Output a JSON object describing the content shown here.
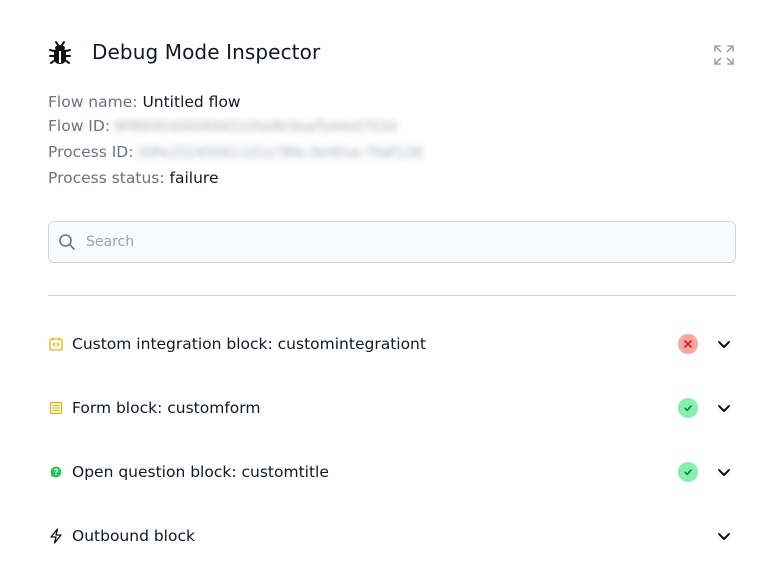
{
  "header": {
    "title": "Debug Mode Inspector",
    "icon": "bug-icon",
    "expand_icon": "expand-icon"
  },
  "meta": {
    "flow_name_label": "Flow name:",
    "flow_name_value": "Untitled flow",
    "flow_id_label": "Flow ID:",
    "flow_id_value": "8ff86954060694510fa9b3baf5d4e07034",
    "process_id_label": "Process ID:",
    "process_id_value": "IDPe25245041101e789c3bf45ac70df128",
    "process_status_label": "Process status:",
    "process_status_value": "failure"
  },
  "search": {
    "placeholder": "Search",
    "value": ""
  },
  "blocks": [
    {
      "label": "Custom integration block: customintegrationt",
      "icon": "code-block-icon",
      "status": "failure"
    },
    {
      "label": "Form block: customform",
      "icon": "form-icon",
      "status": "success"
    },
    {
      "label": "Open question block: customtitle",
      "icon": "question-icon",
      "status": "success"
    },
    {
      "label": "Outbound block",
      "icon": "lightning-icon",
      "status": "none"
    }
  ],
  "colors": {
    "failure": "#fca5a5",
    "success": "#86efac",
    "accent_yellow": "#eab308",
    "accent_green": "#22c55e"
  }
}
